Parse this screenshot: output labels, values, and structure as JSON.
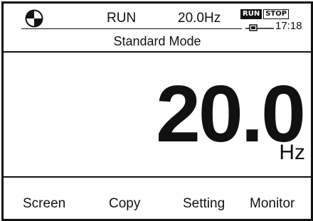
{
  "status": {
    "direction_icon": "rotation-direction-icon",
    "run_state": "RUN",
    "frequency": "20.0Hz",
    "run_indicator": "RUN",
    "stop_indicator": "STOP",
    "battery_icon": "battery-icon",
    "time": "17:18"
  },
  "mode": {
    "title": "Standard Mode"
  },
  "display": {
    "value": "20.0",
    "unit": "Hz"
  },
  "softkeys": [
    "Screen",
    "Copy",
    "Setting",
    "Monitor"
  ],
  "colors": {
    "foreground": "#111111",
    "background": "#ffffff"
  }
}
